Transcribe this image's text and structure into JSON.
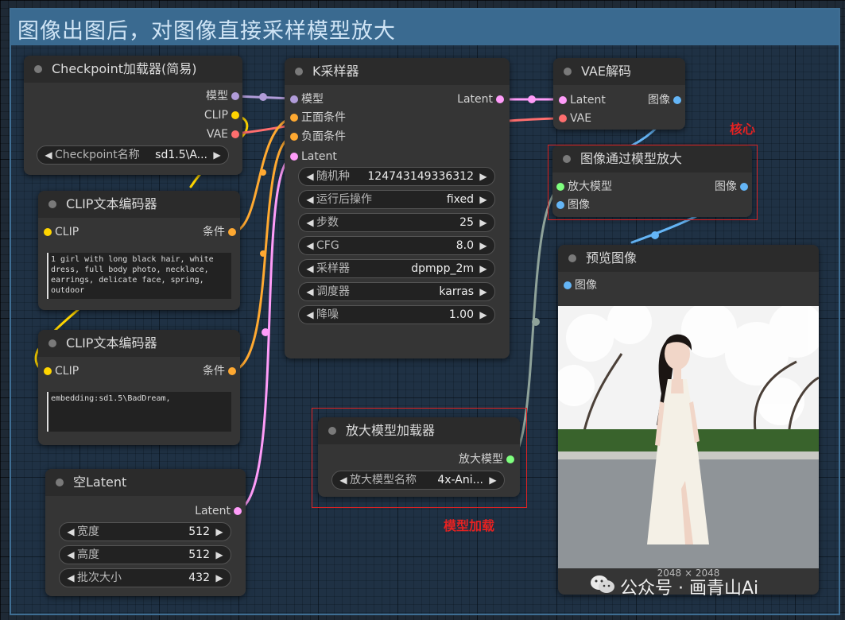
{
  "group_title": "图像出图后，对图像直接采样模型放大",
  "colors": {
    "model": "#b19cd9",
    "clip": "#ffd500",
    "vae": "#ff6e6e",
    "conditioning": "#ffa931",
    "latent": "#ff9cf9",
    "image": "#64b5f6",
    "upscale_model": "#7fff7f"
  },
  "checkpoint_loader": {
    "title": "Checkpoint加载器(简易)",
    "outputs": [
      "模型",
      "CLIP",
      "VAE"
    ],
    "widget_label": "Checkpoint名称",
    "widget_value": "sd1.5\\A..."
  },
  "clip_encoder_pos": {
    "title": "CLIP文本编码器",
    "input": "CLIP",
    "output": "条件",
    "text": "1 girl with long black hair, white dress, full body photo, necklace, earrings, delicate face, spring, outdoor"
  },
  "clip_encoder_neg": {
    "title": "CLIP文本编码器",
    "input": "CLIP",
    "output": "条件",
    "text": "embedding:sd1.5\\BadDream,"
  },
  "empty_latent": {
    "title": "空Latent",
    "output": "Latent",
    "widgets": [
      {
        "label": "宽度",
        "value": "512"
      },
      {
        "label": "高度",
        "value": "512"
      },
      {
        "label": "批次大小",
        "value": "432"
      }
    ]
  },
  "ksampler": {
    "title": "K采样器",
    "inputs": [
      "模型",
      "正面条件",
      "负面条件",
      "Latent"
    ],
    "output": "Latent",
    "widgets": [
      {
        "label": "随机种",
        "value": "124743149336312"
      },
      {
        "label": "运行后操作",
        "value": "fixed"
      },
      {
        "label": "步数",
        "value": "25"
      },
      {
        "label": "CFG",
        "value": "8.0"
      },
      {
        "label": "采样器",
        "value": "dpmpp_2m"
      },
      {
        "label": "调度器",
        "value": "karras"
      },
      {
        "label": "降噪",
        "value": "1.00"
      }
    ]
  },
  "vae_decode": {
    "title": "VAE解码",
    "inputs": [
      "Latent",
      "VAE"
    ],
    "output": "图像"
  },
  "upscale_with_model": {
    "title": "图像通过模型放大",
    "inputs": [
      "放大模型",
      "图像"
    ],
    "output": "图像"
  },
  "preview_image": {
    "title": "预览图像",
    "input": "图像",
    "size_text": "2048 × 2048"
  },
  "upscale_loader": {
    "title": "放大模型加载器",
    "output": "放大模型",
    "widget_label": "放大模型名称",
    "widget_value": "4x-Ani..."
  },
  "annotations": {
    "core": "核心",
    "model_load": "模型加载"
  },
  "watermark": "公众号 · 画青山Ai"
}
